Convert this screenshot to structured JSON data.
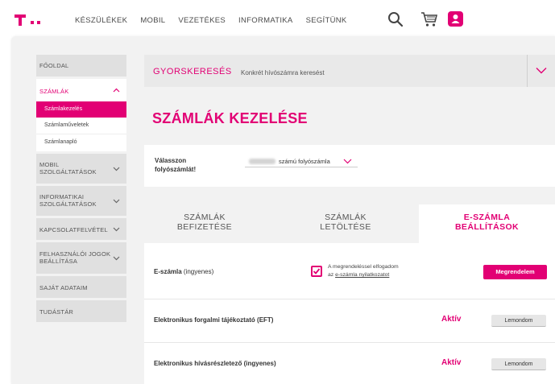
{
  "nav": {
    "items": [
      "KÉSZÜLÉKEK",
      "MOBIL",
      "VEZETÉKES",
      "INFORMATIKA",
      "SEGÍTÜNK"
    ],
    "icons": [
      "search-icon",
      "cart-icon",
      "user-icon"
    ]
  },
  "colors": {
    "brand": "#e20074"
  },
  "sidebar": {
    "home": "FŐOLDAL",
    "bills": "SZÁMLÁK",
    "bills_sub": [
      "Számlakezelés",
      "Számlaműveletek",
      "Számlanapló"
    ],
    "mobile": [
      "MOBIL",
      "SZOLGÁLTATÁSOK"
    ],
    "it": [
      "INFORMATIKAI",
      "SZOLGÁLTATÁSOK"
    ],
    "contact": "KAPCSOLATFELVÉTEL",
    "rights": [
      "FELHASZNÁLÓI JOGOK",
      "BEÁLLÍTÁSA"
    ],
    "mydata": "SAJÁT ADATAIM",
    "library": "TUDÁSTÁR"
  },
  "quicksearch": {
    "title": "GYORSKERESÉS",
    "subtitle": "Konkrét hívószámra keresést"
  },
  "page_title": "SZÁMLÁK KEZELÉSE",
  "account": {
    "label_line1": "Válasszon",
    "label_line2": "folyószámlát!",
    "selected": "számú folyószámla"
  },
  "tabs": [
    {
      "line1": "SZÁMLÁK",
      "line2": "BEFIZETÉSE"
    },
    {
      "line1": "SZÁMLÁK",
      "line2": "LETÖLTÉSE"
    },
    {
      "line1": "E-SZÁMLA",
      "line2": "BEÁLLÍTÁSOK"
    }
  ],
  "rows": {
    "eszamla": {
      "label_bold": "E-számla",
      "label_rest": " (ingyenes)",
      "accept_line1": "A megrendeléssel elfogadom",
      "accept_prefix": "az ",
      "accept_link": "e-számla nyilatkozatot",
      "button": "Megrendelem"
    },
    "eft": {
      "label": "Elektronikus forgalmi tájékoztató (EFT)",
      "status": "Aktív",
      "button": "Lemondom"
    },
    "hrl": {
      "label": "Elektronikus hívásrészletező (ingyenes)",
      "status": "Aktív",
      "button": "Lemondom"
    }
  }
}
